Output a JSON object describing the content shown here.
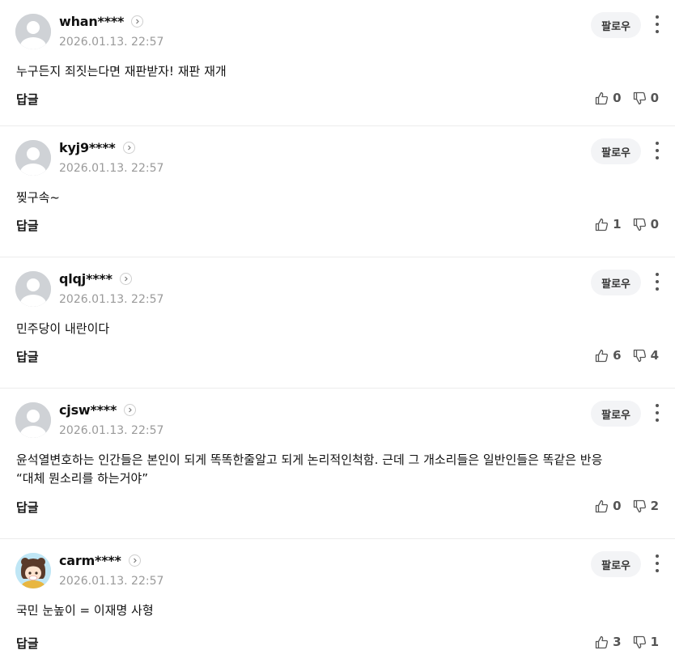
{
  "follow_label": "팔로우",
  "reply_label": "답글",
  "comments": [
    {
      "username": "whan****",
      "timestamp": "2026.01.13. 22:57",
      "text": "누구든지 죄짓는다면 재판받자! 재판 재개",
      "likes": "0",
      "dislikes": "0",
      "avatar": "default"
    },
    {
      "username": "kyj9****",
      "timestamp": "2026.01.13. 22:57",
      "text": "찢구속~",
      "likes": "1",
      "dislikes": "0",
      "avatar": "default"
    },
    {
      "username": "qlqj****",
      "timestamp": "2026.01.13. 22:57",
      "text": "민주당이 내란이다",
      "likes": "6",
      "dislikes": "4",
      "avatar": "default"
    },
    {
      "username": "cjsw****",
      "timestamp": "2026.01.13. 22:57",
      "text": "윤석열변호하는 인간들은 본인이 되게 똑똑한줄알고 되게 논리적인척함. 근데 그 개소리들은 일반인들은 똑같은 반응\n“대체 뭔소리를 하는거야”",
      "likes": "0",
      "dislikes": "2",
      "avatar": "default"
    },
    {
      "username": "carm****",
      "timestamp": "2026.01.13. 22:57",
      "text": "국민 눈높이 = 이재명 사형",
      "likes": "3",
      "dislikes": "1",
      "avatar": "character"
    }
  ]
}
